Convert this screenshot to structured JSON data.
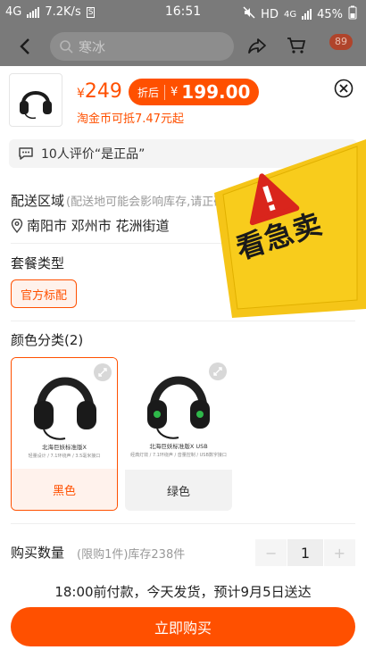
{
  "status_bar": {
    "network": "4G",
    "speed": "7.2K/s",
    "time": "16:51",
    "hd": "HD",
    "net2": "4G",
    "battery": "45%"
  },
  "top_bar": {
    "search_placeholder": "寒冰",
    "cart_badge": "89"
  },
  "product": {
    "price_symbol": "¥",
    "price": "249",
    "after_tag": "折后",
    "after_symbol": "¥",
    "after_price": "199.00",
    "coin_text": "淘金币可抵7.47元起",
    "thumb_caption": "北海巨妖标准版X"
  },
  "review": {
    "text": "10人评价“是正品”"
  },
  "delivery_section": {
    "title": "配送区域",
    "hint": "(配送地可能会影响库存,请正确",
    "address": "南阳市 邓州市 花洲街道"
  },
  "package_section": {
    "title": "套餐类型",
    "option": "官方标配"
  },
  "color_section": {
    "title": "颜色分类(2)",
    "options": [
      {
        "caption": "北海巨妖标准版X",
        "sub": "轻量设计 / 7.1环绕声 / 3.5毫米接口",
        "label": "黑色"
      },
      {
        "caption": "北海巨妖标准版X USB",
        "sub": "经典灯效 / 7.1环绕声 / 音量控制 / USB数字接口",
        "label": "绿色"
      }
    ]
  },
  "quantity_section": {
    "title": "购买数量",
    "hint": "(限购1件)库存238件",
    "minus": "−",
    "value": "1",
    "plus": "+"
  },
  "delivery_note": "18:00前付款，今天发货，预计9月5日送达",
  "buy_button": "立即购买",
  "sticker": {
    "text": "看急卖",
    "color": "#f2c200"
  },
  "colors": {
    "accent": "#ff5000",
    "accent_bg": "#fff2ec"
  }
}
